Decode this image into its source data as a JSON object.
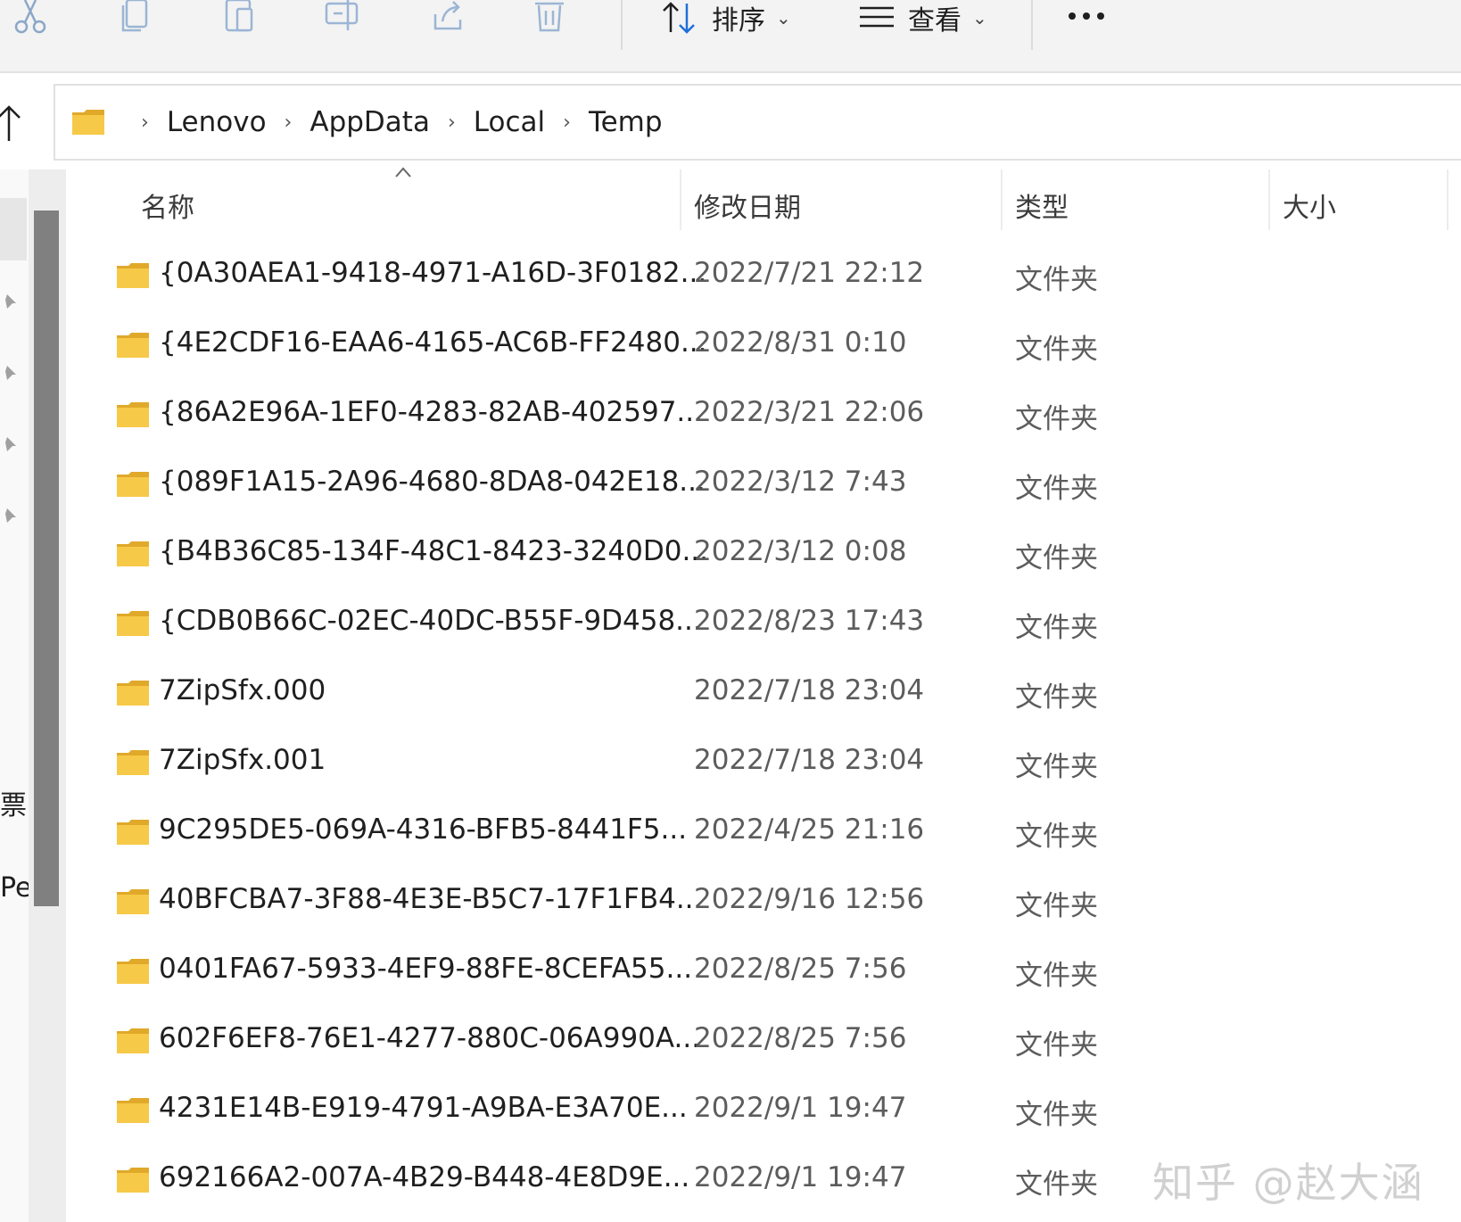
{
  "toolbar": {
    "sort_label": "排序",
    "view_label": "查看",
    "icons": [
      "cut-icon",
      "copy-icon",
      "paste-icon",
      "rename-icon",
      "share-icon",
      "delete-icon",
      "sort-icon",
      "view-icon",
      "more-icon"
    ]
  },
  "breadcrumb": [
    "Lenovo",
    "AppData",
    "Local",
    "Temp"
  ],
  "columns": {
    "name": "名称",
    "date": "修改日期",
    "type": "类型",
    "size": "大小"
  },
  "nav": {
    "partial_text_1": "票扌",
    "partial_text_2": "Pe"
  },
  "files": [
    {
      "name": "{0A30AEA1-9418-4971-A16D-3F0182...",
      "date": "2022/7/21 22:12",
      "type": "文件夹"
    },
    {
      "name": "{4E2CDF16-EAA6-4165-AC6B-FF2480...",
      "date": "2022/8/31 0:10",
      "type": "文件夹"
    },
    {
      "name": "{86A2E96A-1EF0-4283-82AB-402597...",
      "date": "2022/3/21 22:06",
      "type": "文件夹"
    },
    {
      "name": "{089F1A15-2A96-4680-8DA8-042E18...",
      "date": "2022/3/12 7:43",
      "type": "文件夹"
    },
    {
      "name": "{B4B36C85-134F-48C1-8423-3240D0...",
      "date": "2022/3/12 0:08",
      "type": "文件夹"
    },
    {
      "name": "{CDB0B66C-02EC-40DC-B55F-9D458...",
      "date": "2022/8/23 17:43",
      "type": "文件夹"
    },
    {
      "name": "7ZipSfx.000",
      "date": "2022/7/18 23:04",
      "type": "文件夹"
    },
    {
      "name": "7ZipSfx.001",
      "date": "2022/7/18 23:04",
      "type": "文件夹"
    },
    {
      "name": "9C295DE5-069A-4316-BFB5-8441F5...",
      "date": "2022/4/25 21:16",
      "type": "文件夹"
    },
    {
      "name": "40BFCBA7-3F88-4E3E-B5C7-17F1FB4...",
      "date": "2022/9/16 12:56",
      "type": "文件夹"
    },
    {
      "name": "0401FA67-5933-4EF9-88FE-8CEFA55...",
      "date": "2022/8/25 7:56",
      "type": "文件夹"
    },
    {
      "name": "602F6EF8-76E1-4277-880C-06A990A...",
      "date": "2022/8/25 7:56",
      "type": "文件夹"
    },
    {
      "name": "4231E14B-E919-4791-A9BA-E3A70E...",
      "date": "2022/9/1 19:47",
      "type": "文件夹"
    },
    {
      "name": "692166A2-007A-4B29-B448-4E8D9E...",
      "date": "2022/9/1 19:47",
      "type": "文件夹"
    }
  ],
  "watermark": "知乎 @赵大涵",
  "colors": {
    "folder_yellow": "#f7c948",
    "folder_dark": "#e0a92a",
    "toolbar_bg": "#f3f3f3"
  }
}
